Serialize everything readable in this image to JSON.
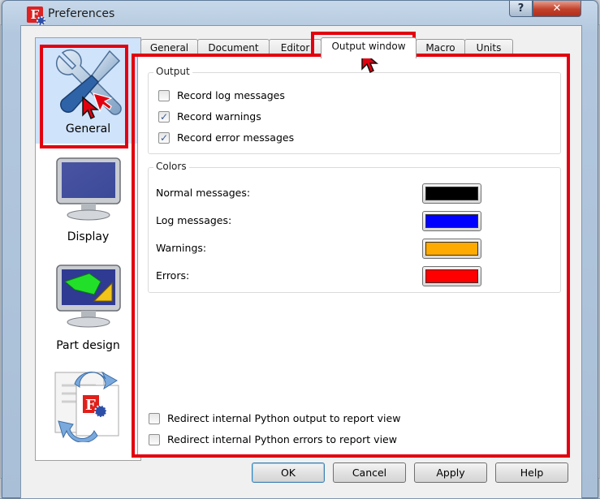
{
  "window": {
    "title": "Preferences",
    "help_button": "?",
    "close_button": "✕"
  },
  "pages": [
    {
      "label": "General",
      "selected": true
    },
    {
      "label": "Display",
      "selected": false
    },
    {
      "label": "Part design",
      "selected": false
    },
    {
      "label": "",
      "selected": false
    }
  ],
  "tabs": [
    {
      "label": "General"
    },
    {
      "label": "Document"
    },
    {
      "label": "Editor"
    },
    {
      "label": "Output window",
      "active": true
    },
    {
      "label": "Macro"
    },
    {
      "label": "Units"
    }
  ],
  "output": {
    "title": "Output",
    "checkboxes": [
      {
        "label": "Record log messages",
        "checked": false
      },
      {
        "label": "Record warnings",
        "checked": true
      },
      {
        "label": "Record error messages",
        "checked": true
      }
    ]
  },
  "colors": {
    "title": "Colors",
    "rows": [
      {
        "label": "Normal messages:",
        "color": "#000000"
      },
      {
        "label": "Log messages:",
        "color": "#0000ff"
      },
      {
        "label": "Warnings:",
        "color": "#ffaa00"
      },
      {
        "label": "Errors:",
        "color": "#ff0000"
      }
    ]
  },
  "redirect": [
    {
      "label": "Redirect internal Python output to report view",
      "checked": false
    },
    {
      "label": "Redirect internal Python errors to report view",
      "checked": false
    }
  ],
  "buttons": {
    "ok": "OK",
    "cancel": "Cancel",
    "apply": "Apply",
    "help": "Help"
  },
  "annotation_color": "#e2000f"
}
